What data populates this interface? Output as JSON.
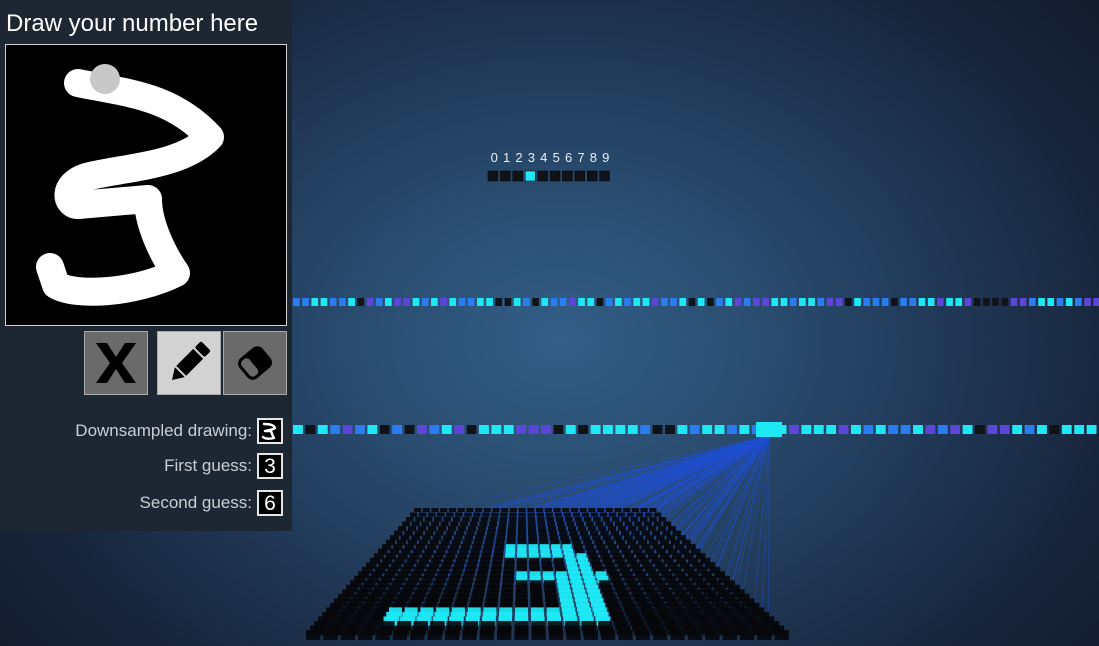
{
  "panel": {
    "title": "Draw your number here",
    "tools": {
      "clear": "clear-x-icon",
      "pencil": "pencil-icon",
      "eraser": "eraser-icon"
    },
    "downsampled_label": "Downsampled drawing:",
    "first_guess_label": "First guess:",
    "first_guess_value": "3",
    "second_guess_label": "Second guess:",
    "second_guess_value": "6"
  },
  "network": {
    "output_labels": [
      "0",
      "1",
      "2",
      "3",
      "4",
      "5",
      "6",
      "7",
      "8",
      "9"
    ],
    "output_active_index": 3,
    "colors": {
      "cyan": "#1de8f4",
      "blue": "#2b7cf0",
      "violet": "#5b46d8",
      "dark": "#101418",
      "link": "#1f4fd0"
    }
  }
}
